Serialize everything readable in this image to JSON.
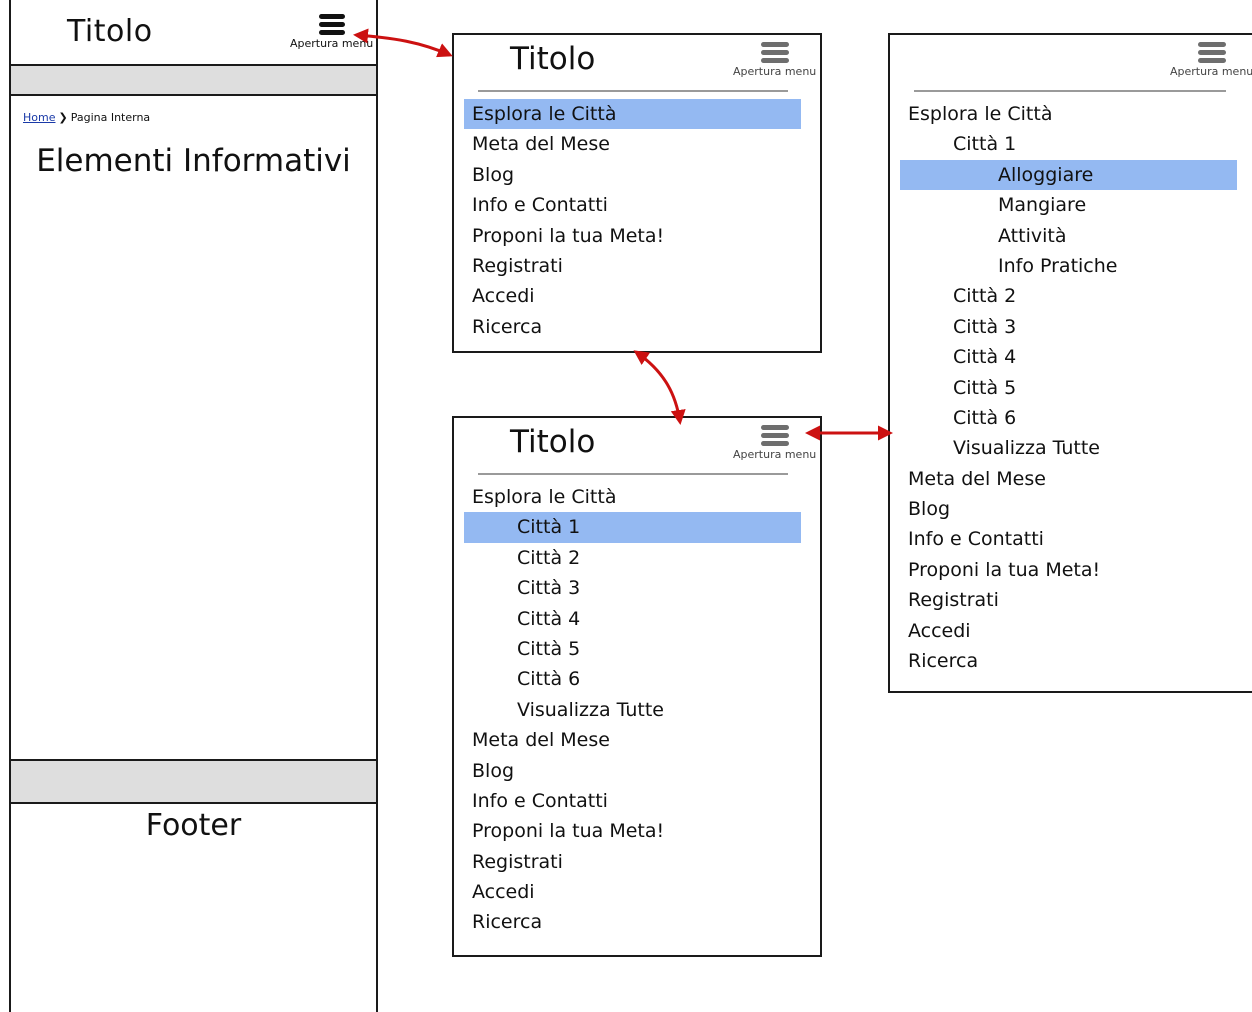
{
  "page": {
    "title": "Titolo",
    "menu_label": "Apertura menu",
    "breadcrumb": {
      "home": "Home",
      "separator": "❯",
      "current": "Pagina Interna"
    },
    "heading": "Elementi Informativi",
    "footer": "Footer"
  },
  "menu_main": {
    "title": "Titolo",
    "menu_label": "Apertura menu",
    "items": [
      "Esplora le Città",
      "Meta del Mese",
      "Blog",
      "Info e Contatti",
      "Proponi la tua Meta!",
      "Registrati",
      "Accedi",
      "Ricerca"
    ],
    "selected": "Esplora le Città"
  },
  "menu_cities": {
    "title": "Titolo",
    "menu_label": "Apertura menu",
    "items": [
      "Esplora le Città",
      "Città 1",
      "Città 2",
      "Città 3",
      "Città 4",
      "Città 5",
      "Città 6",
      "Visualizza Tutte",
      "Meta del Mese",
      "Blog",
      "Info e Contatti",
      "Proponi la tua Meta!",
      "Registrati",
      "Accedi",
      "Ricerca"
    ],
    "selected": "Città 1"
  },
  "menu_city_detail": {
    "menu_label": "Apertura menu",
    "items": [
      "Esplora le Città",
      "Città 1",
      "Alloggiare",
      "Mangiare",
      "Attività",
      "Info Pratiche",
      "Città 2",
      "Città 3",
      "Città 4",
      "Città 5",
      "Città 6",
      "Visualizza Tutte",
      "Meta del Mese",
      "Blog",
      "Info e Contatti",
      "Proponi la tua Meta!",
      "Registrati",
      "Accedi",
      "Ricerca"
    ],
    "selected": "Alloggiare"
  },
  "colors": {
    "highlight": "#94b9f2",
    "arrow": "#cc1111",
    "band": "#dedede",
    "border": "#1a1a1a"
  }
}
